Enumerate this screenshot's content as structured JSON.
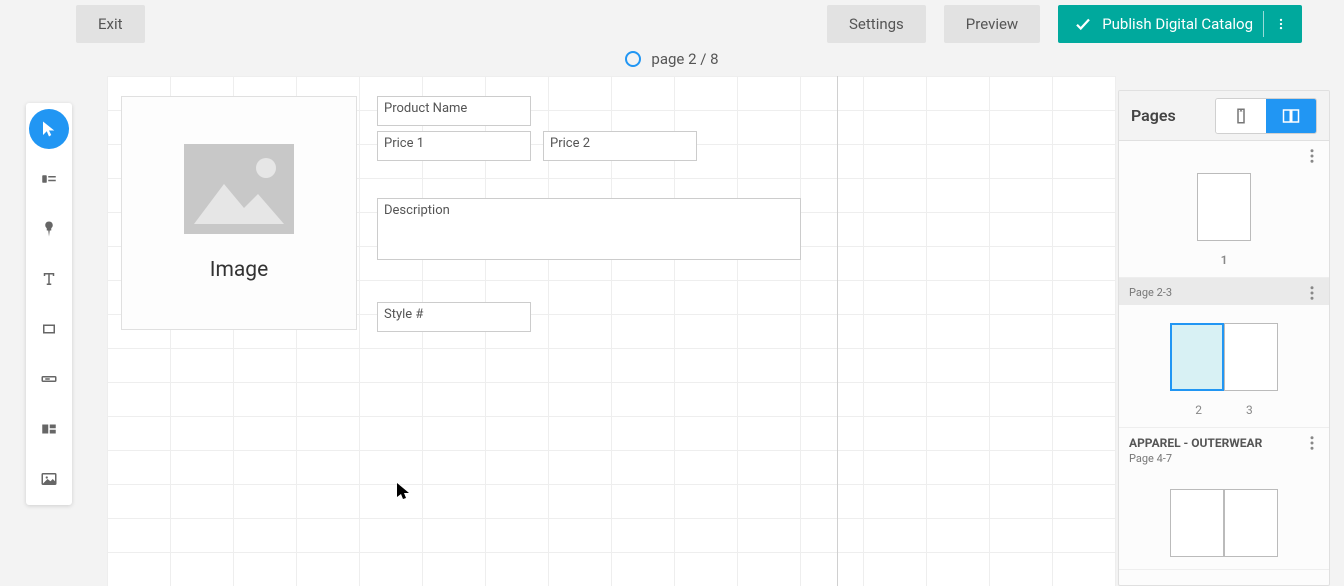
{
  "topbar": {
    "exit": "Exit",
    "settings": "Settings",
    "preview": "Preview",
    "publish": "Publish Digital Catalog"
  },
  "page_indicator": "page 2 / 8",
  "canvas": {
    "image_label": "Image",
    "fields": {
      "product_name": "Product Name",
      "price1": "Price 1",
      "price2": "Price 2",
      "description": "Description",
      "style": "Style #"
    }
  },
  "pages_panel": {
    "title": "Pages",
    "groups": [
      {
        "section_title": "",
        "subtitle": "",
        "pages": [
          "1"
        ],
        "selected": false,
        "single": true
      },
      {
        "section_title": "",
        "subtitle": "Page 2-3",
        "pages": [
          "2",
          "3"
        ],
        "selected": true,
        "active_page_index": 0
      },
      {
        "section_title": "APPAREL - OUTERWEAR",
        "subtitle": "Page 4-7",
        "pages": [
          "",
          ""
        ],
        "selected": false
      }
    ]
  }
}
